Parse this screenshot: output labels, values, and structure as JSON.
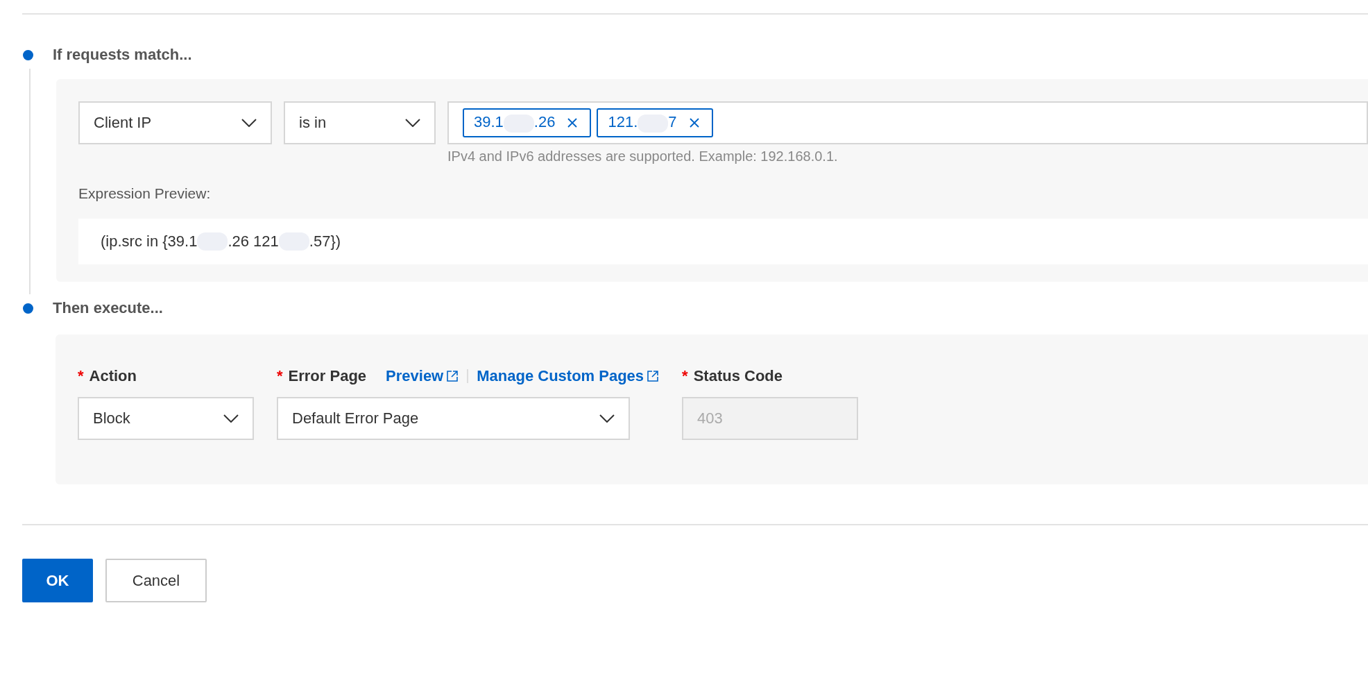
{
  "match": {
    "title": "If requests match...",
    "field": {
      "value": "Client IP"
    },
    "operator": {
      "value": "is in"
    },
    "tags": [
      {
        "prefix": "39.1",
        "suffix": ".26"
      },
      {
        "prefix": "121.",
        "suffix": "7"
      }
    ],
    "hint": "IPv4 and IPv6 addresses are supported. Example: 192.168.0.1.",
    "preview_label": "Expression Preview:",
    "preview_parts": [
      "(ip.src in {39.1",
      ".26 121",
      ".57})"
    ]
  },
  "execute": {
    "title": "Then execute...",
    "action": {
      "required_mark": "*",
      "label": "Action",
      "value": "Block",
      "disabled": false
    },
    "error_page": {
      "required_mark": "*",
      "label": "Error Page",
      "value": "Default Error Page",
      "links": [
        "Preview",
        "Manage Custom Pages"
      ],
      "disabled": false
    },
    "status_code": {
      "required_mark": "*",
      "label": "Status Code",
      "value": "403",
      "disabled": true
    }
  },
  "buttons": [
    {
      "label": "OK",
      "kind": "primary"
    },
    {
      "label": "Cancel",
      "kind": "default"
    }
  ]
}
